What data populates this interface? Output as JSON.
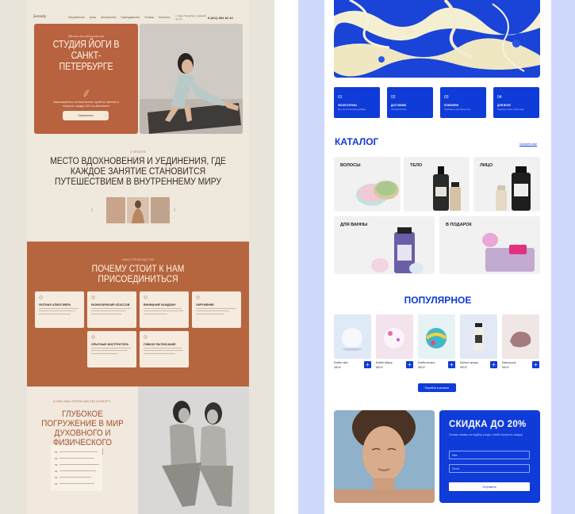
{
  "left_mock": {
    "nav": {
      "logo": "Serenity",
      "menu": [
        "Направления",
        "Цены",
        "Абонементы",
        "Преподаватели",
        "Отзывы",
        "Контакты"
      ],
      "address": "г. Санкт-Петербург, Невский пр. 15",
      "phone": "8 (812) 984 82 44"
    },
    "hero": {
      "subtitle": "Место для вдохновения",
      "title": "СТУДИЯ ЙОГИ В САНКТ-ПЕТЕРБУРГЕ",
      "text": "Записывайтесь на бесплатное пробное занятие и получите скидку 10% на абонемент",
      "button": "Записаться",
      "button_arrow": "›"
    },
    "about": {
      "tag": "О ПРОЕКТЕ",
      "title": "МЕСТО ВДОХНОВЕНИЯ И УЕДИНЕНИЯ, ГДЕ КАЖДОЕ ЗАНЯТИЕ СТАНОВИТСЯ ПУТЕШЕСТВИЕМ В ВНУТРЕННЕМУ МИРУ",
      "prev_glyph": "‹",
      "next_glyph": "›"
    },
    "why": {
      "tag": "НАШИ ПРЕИМУЩЕСТВА",
      "title": "ПОЧЕМУ СТОИТ К НАМ ПРИСОЕДИНИТЬСЯ",
      "cards": [
        {
          "title": "УЮТНАЯ АТМОСФЕРА"
        },
        {
          "title": "РАЗНООБРАЗИЕ КЛАССОВ"
        },
        {
          "title": "ВНИМАНИЕ КАЖДОМУ"
        },
        {
          "title": "ОКРУЖЕНИЕ"
        },
        {
          "title": "ОПЫТНЫЕ ИНСТРУКТОРА"
        },
        {
          "title": "ГИБКОЕ РАСПИСАНИЕ"
        }
      ]
    },
    "dive": {
      "tag": "В ЧЕМ НАШИ ПРЕИМУЩЕСТВА КОМФОРТ?",
      "title": "ГЛУБОКОЕ ПОГРУЖЕНИЕ В МИР ДУХОВНОГО И ФИЗИЧЕСКОГО РАЗВИТИЯ",
      "list_numbers": [
        "01",
        "02",
        "03",
        "04",
        "05",
        "06"
      ]
    }
  },
  "right_mock": {
    "features": [
      {
        "num": "01",
        "title": "ЭКОЛОГИЧНЫ",
        "sub": "Без, не используем добавки"
      },
      {
        "num": "02",
        "title": "ДОСТАВИМ",
        "sub": "По всей России"
      },
      {
        "num": "03",
        "title": "ПОМОЖЕМ",
        "sub": "Подберем уход бесплатно"
      },
      {
        "num": "04",
        "title": "ДЛЯ ВСЕХ",
        "sub": "Подходит всем типам кожи"
      }
    ],
    "catalog": {
      "title": "КАТАЛОГ",
      "link": "Смотреть все",
      "categories": [
        "ВОЛОСЫ",
        "ТЕЛО",
        "ЛИЦО",
        "ДЛЯ ВАННЫ",
        "В ПОДАРОК"
      ]
    },
    "popular": {
      "title": "ПОПУЛЯРНОЕ",
      "products": [
        {
          "name": "Бомба лайт",
          "price": "450 ₽",
          "color": "#dfe9f8"
        },
        {
          "name": "Бомба эйфор",
          "price": "660 ₽",
          "color": "#f3e3ec"
        },
        {
          "name": "Бомба космос",
          "price": "590 ₽",
          "color": "#e7f2f4"
        },
        {
          "name": "Молоко цитрус",
          "price": "990 ₽",
          "color": "#e3e8f7"
        },
        {
          "name": "Маска роза",
          "price": "990 ₽",
          "color": "#f0e6e6"
        }
      ],
      "plus_glyph": "+",
      "cta": "Перейти в каталог"
    },
    "promo": {
      "title": "СКИДКА ДО 20%",
      "text": "Оставь заявку на подбор ухода, чтобы получить скидку",
      "name_placeholder": "Имя",
      "phone_placeholder": "Почта",
      "submit": "Отправить"
    }
  },
  "colors": {
    "terracotta": "#b8623f",
    "cream": "#efe8dc",
    "brand_blue": "#0f3bd8",
    "right_bg": "#cfd9fb"
  }
}
